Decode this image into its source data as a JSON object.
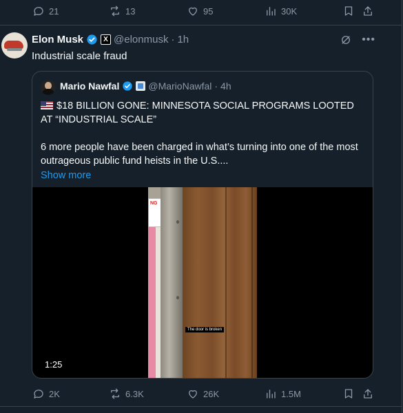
{
  "prev_tweet_actions": {
    "replies": "21",
    "reposts": "13",
    "likes": "95",
    "views": "30K"
  },
  "tweet": {
    "author_name": "Elon Musk",
    "affiliate_badge": "X",
    "handle": "@elonmusk",
    "separator": "·",
    "time": "1h",
    "text": "Industrial scale fraud",
    "actions": {
      "replies": "2K",
      "reposts": "6.3K",
      "likes": "26K",
      "views": "1.5M"
    }
  },
  "quoted_tweet": {
    "author_name": "Mario Nawfal",
    "handle": "@MarioNawfal",
    "separator": "·",
    "time": "4h",
    "headline": "$18 BILLION GONE: MINNESOTA SOCIAL PROGRAMS LOOTED AT “INDUSTRIAL SCALE”",
    "body": "6 more people have been charged in what’s turning into one of the most outrageous public fund heists in the U.S....",
    "show_more": "Show more",
    "video": {
      "duration": "1:25",
      "caption": "The door is broken",
      "sign_text": "NG"
    }
  },
  "colors": {
    "background": "#15202b",
    "border": "#38444d",
    "text_primary": "#f7f9f9",
    "text_secondary": "#8b98a5",
    "link": "#1d9bf0",
    "verified": "#1d9bf0"
  },
  "icons": [
    "reply-icon",
    "repost-icon",
    "like-icon",
    "views-icon",
    "bookmark-icon",
    "share-icon",
    "grok-icon",
    "more-icon",
    "verified-icon",
    "us-flag-icon"
  ]
}
